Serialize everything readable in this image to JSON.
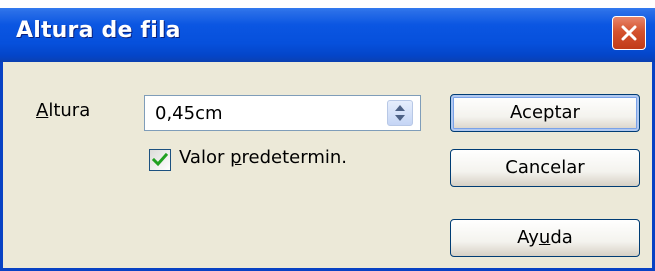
{
  "dialog": {
    "title": "Altura de fila"
  },
  "height": {
    "label_first": "A",
    "label_rest": "ltura",
    "value": "0,45cm"
  },
  "default_value": {
    "checked": true,
    "label_before": "Valor ",
    "label_ul": "p",
    "label_after": "redetermin."
  },
  "buttons": {
    "accept": "Aceptar",
    "cancel": "Cancelar",
    "help_before": "Ay",
    "help_ul": "u",
    "help_after": "da"
  },
  "icons": {
    "close": "close-icon",
    "spin": "spin-arrows-icon",
    "check": "checkmark-icon"
  },
  "colors": {
    "titlebar": "#0650dc",
    "close": "#d4532f",
    "face": "#ece9d8",
    "check": "#21a121"
  }
}
